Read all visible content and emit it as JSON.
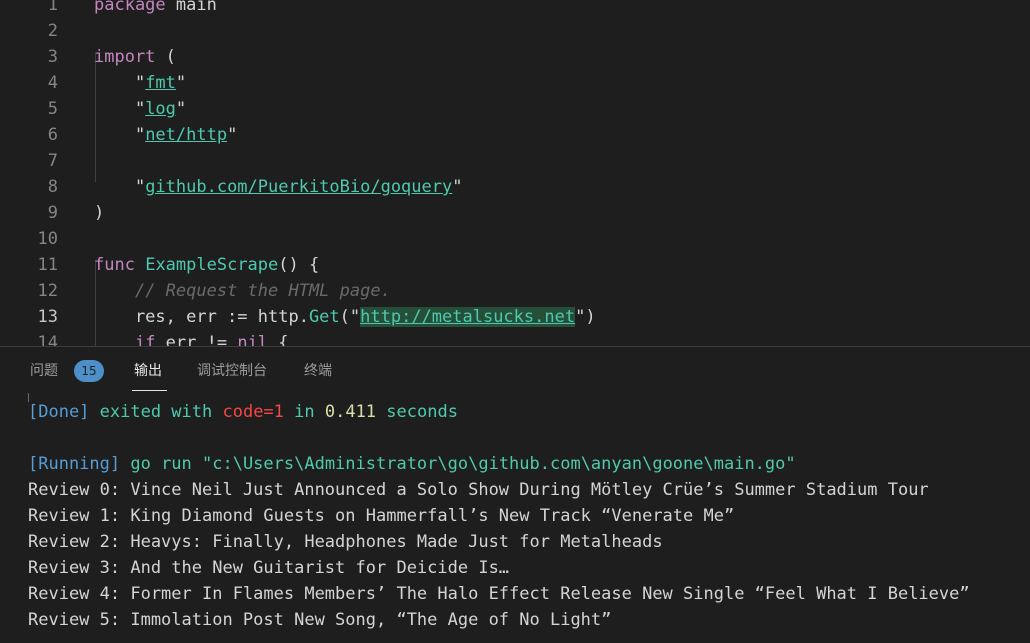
{
  "editor": {
    "lines": [
      {
        "num": "1",
        "parts": [
          [
            "kw",
            "package"
          ],
          [
            "var",
            " main"
          ]
        ]
      },
      {
        "num": "2",
        "parts": []
      },
      {
        "num": "3",
        "parts": [
          [
            "kw",
            "import"
          ],
          [
            "punc",
            " ("
          ]
        ]
      },
      {
        "num": "4",
        "parts": [
          [
            "punc",
            "    \""
          ],
          [
            "str-u",
            "fmt"
          ],
          [
            "punc",
            "\""
          ]
        ]
      },
      {
        "num": "5",
        "parts": [
          [
            "punc",
            "    \""
          ],
          [
            "str-u",
            "log"
          ],
          [
            "punc",
            "\""
          ]
        ]
      },
      {
        "num": "6",
        "parts": [
          [
            "punc",
            "    \""
          ],
          [
            "str-u",
            "net/http"
          ],
          [
            "punc",
            "\""
          ]
        ]
      },
      {
        "num": "7",
        "parts": []
      },
      {
        "num": "8",
        "parts": [
          [
            "punc",
            "    \""
          ],
          [
            "str-u",
            "github.com/PuerkitoBio/goquery"
          ],
          [
            "punc",
            "\""
          ]
        ]
      },
      {
        "num": "9",
        "parts": [
          [
            "punc",
            ")"
          ]
        ]
      },
      {
        "num": "10",
        "parts": []
      },
      {
        "num": "11",
        "parts": [
          [
            "kw",
            "func"
          ],
          [
            "var",
            " "
          ],
          [
            "fn",
            "ExampleScrape"
          ],
          [
            "punc",
            "() {"
          ]
        ]
      },
      {
        "num": "12",
        "parts": [
          [
            "var",
            "    "
          ],
          [
            "cmt",
            "// Request the HTML page."
          ]
        ]
      },
      {
        "num": "13",
        "parts": [
          [
            "var",
            "    res, err := http."
          ],
          [
            "fn",
            "Get"
          ],
          [
            "punc",
            "(\""
          ],
          [
            "url",
            "http://metalsucks.net"
          ],
          [
            "punc",
            "\")"
          ]
        ]
      },
      {
        "num": "14",
        "parts": [
          [
            "var",
            "    "
          ],
          [
            "kw",
            "if"
          ],
          [
            "var",
            " err != "
          ],
          [
            "kw",
            "nil"
          ],
          [
            "punc",
            " {"
          ]
        ]
      }
    ],
    "active_line": "13"
  },
  "panel": {
    "tabs": [
      {
        "label": "问题",
        "active": false
      },
      {
        "label": "输出",
        "active": true
      },
      {
        "label": "调试控制台",
        "active": false
      },
      {
        "label": "终端",
        "active": false
      }
    ],
    "problems_count": "15",
    "output": [
      {
        "parts": [
          [
            "o-tag",
            "[Done]"
          ],
          [
            "o-green",
            " exited with "
          ],
          [
            "o-red",
            "code=1"
          ],
          [
            "o-green",
            " in "
          ],
          [
            "o-num",
            "0.411"
          ],
          [
            "o-green",
            " seconds"
          ]
        ]
      },
      {
        "parts": []
      },
      {
        "parts": [
          [
            "o-tag",
            "[Running]"
          ],
          [
            "o-cmd",
            " go run \"c:\\Users\\Administrator\\go\\github.com\\anyan\\goone\\main.go\""
          ]
        ]
      },
      {
        "parts": [
          [
            "plain",
            "Review 0: Vince Neil Just Announced a Solo Show During Mötley Crüe’s Summer Stadium Tour"
          ]
        ]
      },
      {
        "parts": [
          [
            "plain",
            "Review 1: King Diamond Guests on Hammerfall’s New Track “Venerate Me”"
          ]
        ]
      },
      {
        "parts": [
          [
            "plain",
            "Review 2: Heavys: Finally, Headphones Made Just for Metalheads"
          ]
        ]
      },
      {
        "parts": [
          [
            "plain",
            "Review 3: And the New Guitarist for Deicide Is…"
          ]
        ]
      },
      {
        "parts": [
          [
            "plain",
            "Review 4: Former In Flames Members’ The Halo Effect Release New Single “Feel What I Believe”"
          ]
        ]
      },
      {
        "parts": [
          [
            "plain",
            "Review 5: Immolation Post New Song, “The Age of No Light”"
          ]
        ]
      }
    ]
  }
}
